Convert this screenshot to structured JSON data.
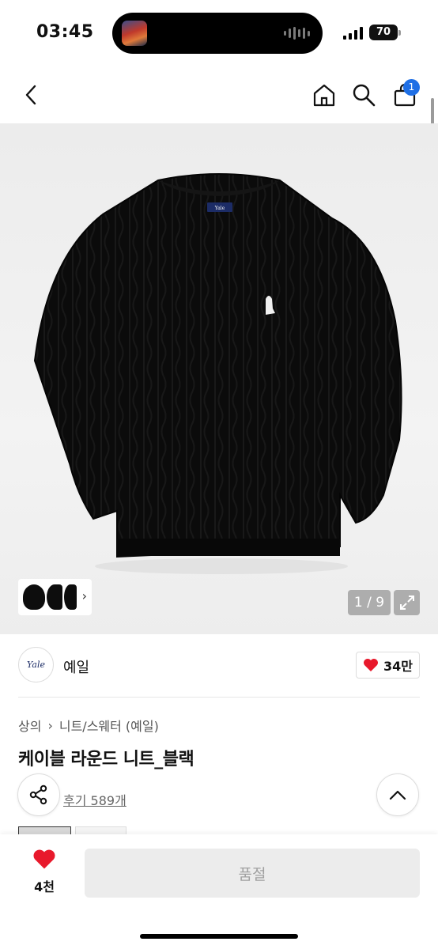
{
  "status": {
    "time": "03:45",
    "battery": "70"
  },
  "header": {
    "back_icon": "chevron-left-icon",
    "home_icon": "home-icon",
    "search_icon": "search-icon",
    "cart_icon": "cart-icon",
    "cart_count": "1",
    "badge_color": "#1f6fe5"
  },
  "gallery": {
    "counter": "1 / 9",
    "expand_icon": "expand-icon",
    "thumbs_arrow": "›"
  },
  "brand": {
    "logo_text": "Yale",
    "name": "예일",
    "like_count": "34만",
    "heart_color": "#e8192c"
  },
  "breadcrumb": {
    "items": [
      "상의",
      "니트/스웨터 (예일)"
    ],
    "separator": "›"
  },
  "product": {
    "title": "케이블 라운드 니트_블랙",
    "review_label": "후기 589개"
  },
  "bottom": {
    "wish_count": "4천",
    "action_label": "품절"
  }
}
